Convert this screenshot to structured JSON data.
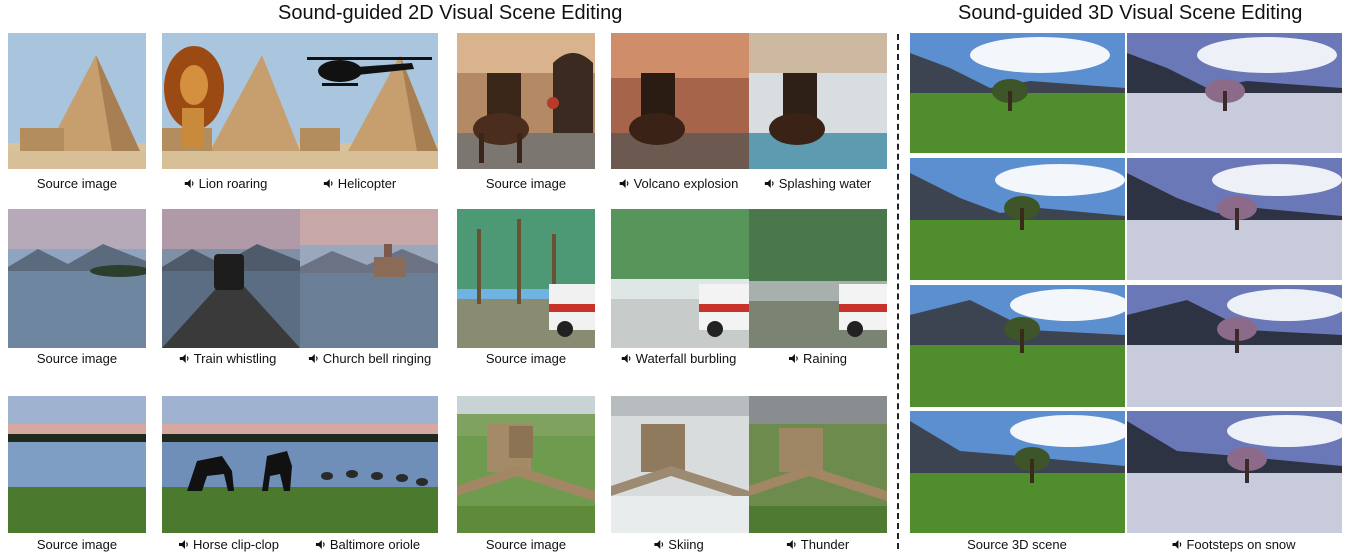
{
  "titles": {
    "left": "Sound-guided 2D Visual Scene Editing",
    "right": "Sound-guided 3D Visual Scene Editing"
  },
  "icon": "speaker-icon",
  "captions": {
    "r1_source_a": "Source image",
    "r1_lion": "Lion roaring",
    "r1_helicopter": "Helicopter",
    "r1_source_b": "Source image",
    "r1_volcano": "Volcano explosion",
    "r1_splashing": "Splashing water",
    "r2_source_a": "Source image",
    "r2_train": "Train whistling",
    "r2_church": "Church bell ringing",
    "r2_source_b": "Source image",
    "r2_waterfall": "Waterfall burbling",
    "r2_raining": "Raining",
    "r3_source_a": "Source image",
    "r3_horse": "Horse clip-clop",
    "r3_oriole": "Baltimore oriole",
    "r3_source_b": "Source image",
    "r3_skiing": "Skiing",
    "r3_thunder": "Thunder",
    "scene_source": "Source 3D scene",
    "scene_footsteps": "Footsteps on snow"
  }
}
